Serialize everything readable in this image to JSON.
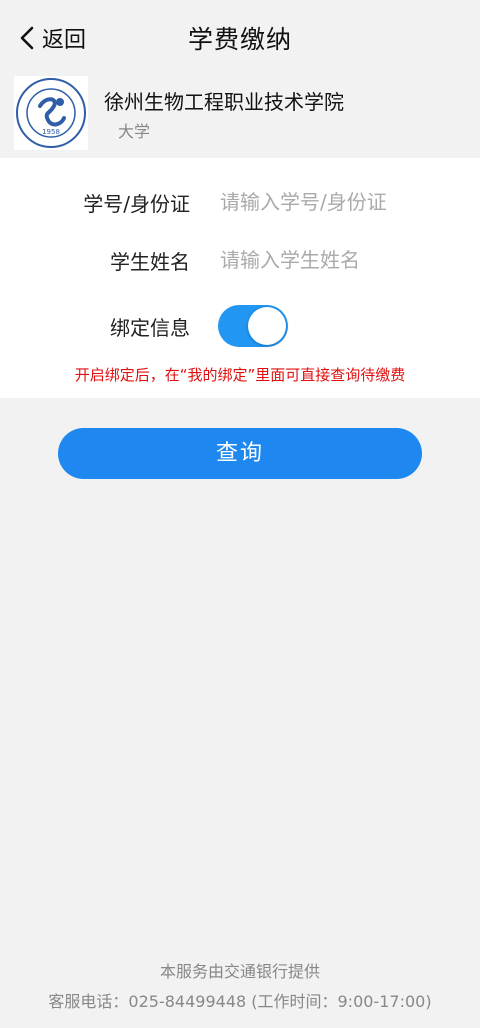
{
  "header": {
    "back_label": "返回",
    "title": "学费缴纳"
  },
  "school": {
    "name": "徐州生物工程职业技术学院",
    "type": "大学",
    "logo_year": "1958"
  },
  "form": {
    "student_id_label": "学号/身份证",
    "student_id_placeholder": "请输入学号/身份证",
    "student_id_value": "",
    "student_name_label": "学生姓名",
    "student_name_placeholder": "请输入学生姓名",
    "student_name_value": "",
    "bind_label": "绑定信息",
    "bind_enabled": true,
    "bind_notice": "开启绑定后，在“我的绑定”里面可直接查询待缴费"
  },
  "actions": {
    "query_label": "查询"
  },
  "footer": {
    "provider": "本服务由交通银行提供",
    "hotline": "客服电话：025-84499448 (工作时间：9:00-17:00)"
  },
  "colors": {
    "accent": "#1e88f0",
    "toggle_on": "#2196f3",
    "warning": "#e01010",
    "logo_blue": "#2f5da8"
  }
}
